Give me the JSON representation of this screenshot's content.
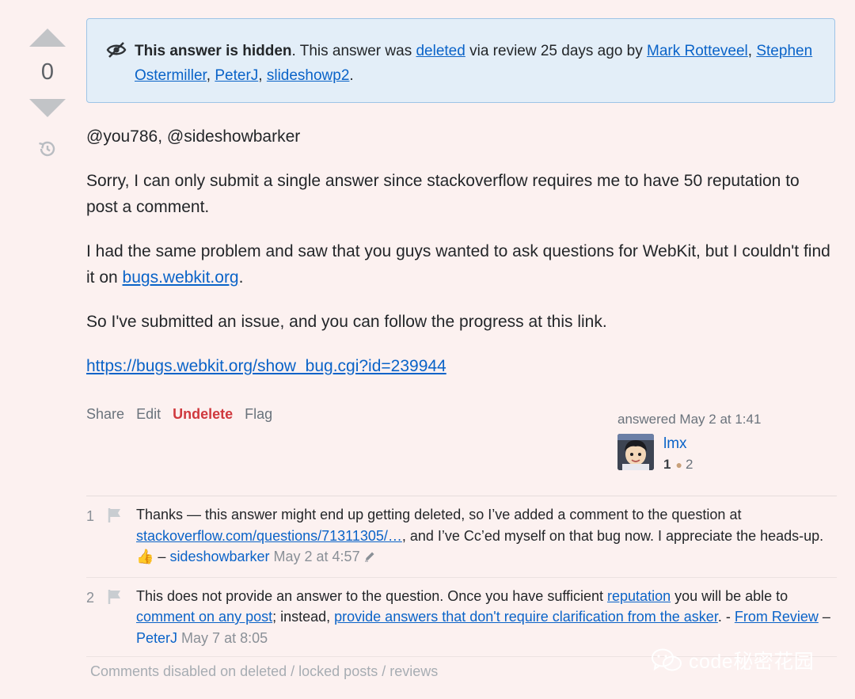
{
  "votes": {
    "count": "0"
  },
  "notice": {
    "bold": "This answer is hidden",
    "text1": ". This answer was ",
    "link_deleted": "deleted",
    "text2": " via review 25 days ago by ",
    "reviewers": [
      "Mark Rotteveel",
      "Stephen Ostermiller",
      "PeterJ",
      "slideshowp2"
    ],
    "end": "."
  },
  "post": {
    "p1": "@you786, @sideshowbarker",
    "p2": "Sorry, I can only submit a single answer since stackoverflow requires me to have 50 reputation to post a comment.",
    "p3_text": "I had the same problem and saw that you guys wanted to ask questions for WebKit, but I couldn't find it on ",
    "p3_link": "bugs.webkit.org",
    "p3_end": ".",
    "p4": "So I've submitted an issue, and you can follow the progress at this link.",
    "p5_link": "https://bugs.webkit.org/show_bug.cgi?id=239944"
  },
  "menu": {
    "share": "Share",
    "edit": "Edit",
    "undelete": "Undelete",
    "flag": "Flag"
  },
  "signature": {
    "action": "answered May 2 at 1:41",
    "user": "lmx",
    "rep": "1",
    "bronze": "2",
    "colors": {
      "bronze": "#c8a07a"
    }
  },
  "comments": [
    {
      "score": "1",
      "t1": "Thanks — this answer might end up getting deleted, so I’ve added a comment to the question at ",
      "link": "stackoverflow.com/questions/71311305/…",
      "t2": ", and I’ve Cc’ed myself on that bug now. I appreciate the heads-up. 👍 – ",
      "user": "sideshowbarker",
      "date": "May 2 at 4:57"
    },
    {
      "score": "2",
      "t1": "This does not provide an answer to the question. Once you have sufficient ",
      "link1": "reputation",
      "t2": " you will be able to ",
      "link2": "comment on any post",
      "t3": "; instead, ",
      "link3": "provide answers that don't require clarification from the asker",
      "t4": ". - ",
      "link4": "From Review",
      "t5": " – ",
      "user": "PeterJ",
      "date": "May 7 at 8:05"
    }
  ],
  "comments_disabled": "Comments disabled on deleted / locked posts / reviews",
  "watermark": "code秘密花园"
}
